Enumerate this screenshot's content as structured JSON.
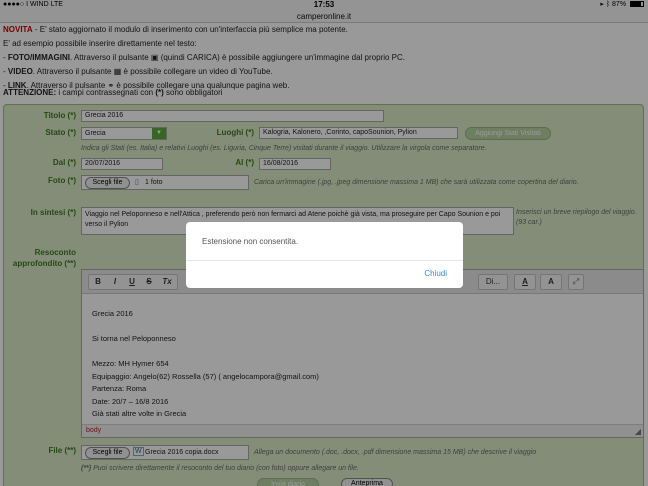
{
  "status_bar": {
    "carrier": "●●●●○ I WIND  LTE",
    "time": "17:53",
    "battery": "87%",
    "battery_level": 0.87
  },
  "url": "camperonline.it",
  "intro": {
    "line1_prefix": "NOVITA",
    "line1_rest": " - E' stato aggiornato il modulo di inserimento con un'interfaccia più semplice ma potente.",
    "line2": "E' ad esempio possibile inserire direttamente nel testo:",
    "foto_label": "FOTO/IMMAGINI",
    "foto_a": ". Attraverso il pulsante ",
    "foto_b": " (quindi CARICA) è possibile aggiungere un'immagine dal proprio PC.",
    "video_label": "VIDEO",
    "video_a": ". Attraverso il pulsante ",
    "video_b": " è possibile collegare un video di YouTube.",
    "link_label": "LINK",
    "link_a": ". Attraverso il pulsante ",
    "link_b": " è possibile collegare una qualunque pagina web."
  },
  "attention": {
    "label": "ATTENZIONE:",
    "text_a": " i campi contrassegnati con ",
    "mark": "(*)",
    "text_b": " sono obbligatori"
  },
  "form": {
    "titolo_label": "Titolo (*)",
    "titolo_value": "Grecia 2016",
    "stato_label": "Stato (*)",
    "stato_value": "Grecia",
    "luoghi_label": "Luoghi (*)",
    "luoghi_value": "Kalogria, Kalonero, ,Corinto, capoSounion, Pylion",
    "aggiungi_button": "Aggiungi Stati Visitati",
    "stati_hint": "Indica gli Stati (es. Italia) e relativi Luoghi (es. Liguria, Cinque Terre) visitati durante il viaggio. Utilizzare la virgola come separatore.",
    "dal_label": "Dal (*)",
    "dal_value": "20/07/2016",
    "al_label": "Al (*)",
    "al_value": "16/08/2016",
    "foto_label": "Foto (*)",
    "foto_button": "Scegli file",
    "foto_value": "1 foto",
    "foto_hint": "Carica un'immagine (.jpg, .jpeg dimensione massima 1 MB) che sarà utilizzata come copertina del diario.",
    "sintesi_label": "In sintesi (*)",
    "sintesi_value": "Viaggio nel Peloponneso e nell'Attica , preferendo però non fermarci ad Atene poichè già vista, ma proseguire per Capo Sounion e poi verso il Pylion",
    "sintesi_hint": "Inserisci un breve riepilogo del viaggio. (93 car.)",
    "resoconto_label": "Resoconto approfondito (**)",
    "file_label": "File (**)",
    "file_button": "Scegli file",
    "file_value": "Grecia 2016 copia.docx",
    "file_hint": "Allega un documento (.doc, .docx, .pdf dimensione massima 15 MB) che descrive il viaggio",
    "note_mark": "(**)",
    "note_text": " Puoi scrivere direttamente il resoconto del tuo diario (con foto) oppure allegare un file.",
    "invia_button": "Invia diario",
    "anteprima_button": "Anteprima"
  },
  "editor": {
    "toolbar": {
      "bold": "B",
      "italic": "I",
      "underline": "U",
      "strike": "S",
      "clear": "Tx",
      "styles": "Di...",
      "text_color": "A",
      "bg_color": "A"
    },
    "lines": [
      "Grecia 2016",
      "",
      "Si torna nel Peloponneso",
      "",
      "Mezzo: MH Hymer 654",
      "Equipaggio: Angelo(62) Rossella (57) ( angelocampora@gmail.com)",
      "Partenza: Roma",
      "Date: 20/7 – 16/8 2016",
      "Già stati altre volte in Grecia"
    ],
    "footer": "body"
  },
  "dialog": {
    "message": "Estensione non consentita.",
    "close": "Chiudi"
  }
}
